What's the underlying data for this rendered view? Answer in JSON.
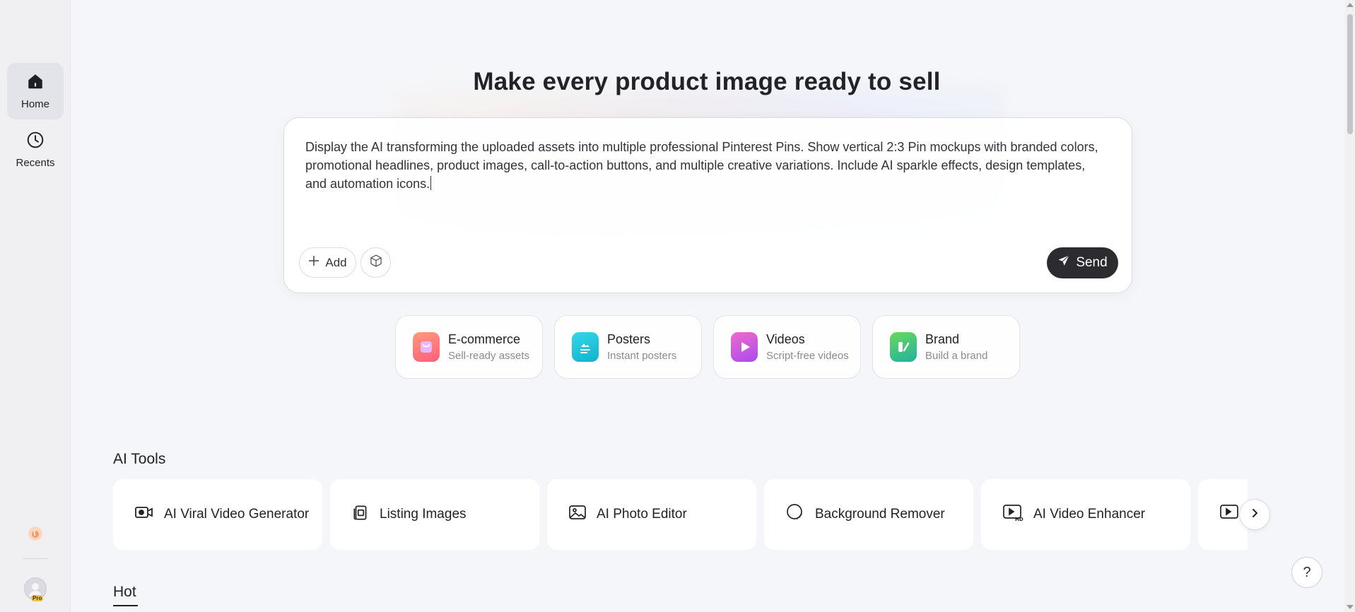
{
  "sidebar": {
    "items": [
      {
        "label": "Home",
        "icon": "home-icon",
        "active": true
      },
      {
        "label": "Recents",
        "icon": "clock-icon",
        "active": false
      }
    ],
    "avatar_badge": "Pro"
  },
  "hero": {
    "title": "Make every product image ready to sell"
  },
  "prompt": {
    "text": "Display the AI transforming the uploaded assets into multiple professional Pinterest Pins. Show vertical 2:3 Pin mockups with branded colors, promotional headlines, product images, call-to-action buttons, and multiple creative variations. Include AI sparkle effects, design templates, and automation icons.",
    "add_label": "Add",
    "send_label": "Send"
  },
  "categories": [
    {
      "title": "E-commerce",
      "subtitle": "Sell-ready assets",
      "icon": "shopping-bag-icon",
      "color": "#ff7a6b"
    },
    {
      "title": "Posters",
      "subtitle": "Instant posters",
      "icon": "poster-icon",
      "color": "#1ec3d8"
    },
    {
      "title": "Videos",
      "subtitle": "Script-free videos",
      "icon": "play-icon",
      "color": "#d04fe6"
    },
    {
      "title": "Brand",
      "subtitle": "Build a brand",
      "icon": "brand-icon",
      "color": "#3fc25a"
    }
  ],
  "ai_tools": {
    "title": "AI Tools",
    "items": [
      {
        "label": "AI Viral Video Generator",
        "icon": "video-camera-icon"
      },
      {
        "label": "Listing Images",
        "icon": "listing-images-icon"
      },
      {
        "label": "AI Photo Editor",
        "icon": "photo-icon"
      },
      {
        "label": "Background Remover",
        "icon": "background-remover-icon"
      },
      {
        "label": "AI Video Enhancer",
        "icon": "hd-video-icon"
      }
    ]
  },
  "hot": {
    "title": "Hot"
  },
  "help_label": "?"
}
